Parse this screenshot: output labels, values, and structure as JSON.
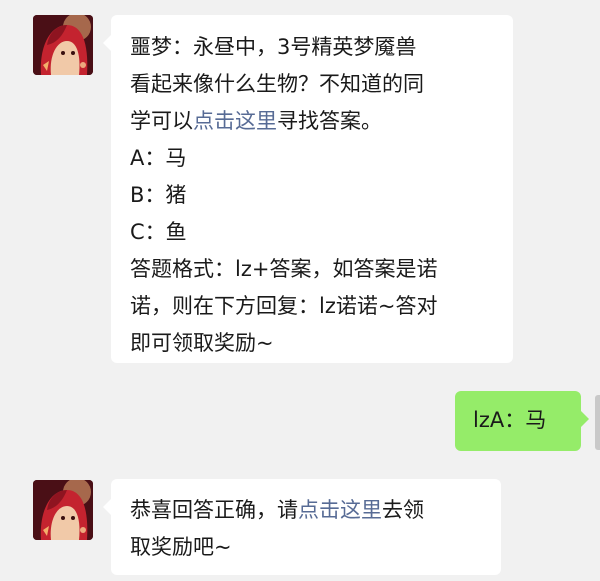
{
  "messages": [
    {
      "side": "left",
      "avatar_icon": "character-avatar-icon",
      "lines": [
        {
          "text": "噩梦：永昼中，3号精英梦魇兽"
        },
        {
          "text": "看起来像什么生物？不知道的同"
        },
        {
          "pre": "学可以",
          "link": "点击这里",
          "post": "寻找答案。"
        },
        {
          "text": "A：马"
        },
        {
          "text": "B：猪"
        },
        {
          "text": "C：鱼"
        },
        {
          "text": "答题格式：lz+答案，如答案是诺"
        },
        {
          "text": "诺，则在下方回复：lz诺诺~答对"
        },
        {
          "text": "即可领取奖励~"
        }
      ]
    },
    {
      "side": "right",
      "text": "lzA：马"
    },
    {
      "side": "left",
      "avatar_icon": "character-avatar-icon",
      "lines": [
        {
          "pre": "恭喜回答正确，请",
          "link": "点击这里",
          "post": "去领"
        },
        {
          "text": "取奖励吧~"
        }
      ]
    }
  ],
  "colors": {
    "background": "#f1f1f1",
    "bubble_left": "#ffffff",
    "bubble_right": "#95ec69",
    "link": "#576b95"
  }
}
